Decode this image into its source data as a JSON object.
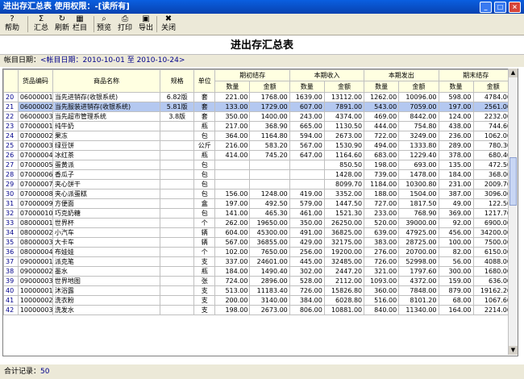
{
  "window": {
    "title": "进出存汇总表  使用权限：-[读所有]"
  },
  "toolbar": [
    {
      "label": "帮助",
      "icon": "help-icon",
      "glyph": "?"
    },
    {
      "label": "汇总",
      "icon": "sigma-icon",
      "glyph": "Σ"
    },
    {
      "label": "刷新",
      "icon": "refresh-icon",
      "glyph": "↻"
    },
    {
      "label": "栏目",
      "icon": "columns-icon",
      "glyph": "▦"
    },
    {
      "label": "预览",
      "icon": "preview-icon",
      "glyph": "⌕"
    },
    {
      "label": "打印",
      "icon": "print-icon",
      "glyph": "⎙"
    },
    {
      "label": "导出",
      "icon": "export-icon",
      "glyph": "▣"
    },
    {
      "label": "关闭",
      "icon": "close-icon",
      "glyph": "✖"
    }
  ],
  "report": {
    "title": "进出存汇总表",
    "date_label": "帐目日期：",
    "date_value": "<帐目日期：2010-10-01 至 2010-10-24>"
  },
  "columns": {
    "code": "货品编码",
    "name": "商品名称",
    "spec": "规格",
    "unit": "单位",
    "groups": [
      "期初结存",
      "本期收入",
      "本期发出",
      "期末结存"
    ],
    "qty": "数量",
    "amount": "金额"
  },
  "rows": [
    {
      "n": "20",
      "code": "06000001",
      "name": "当先进销存(收银系统)",
      "spec": "6.82版",
      "unit": "套",
      "v": [
        "221.00",
        "1768.00",
        "1639.00",
        "13112.00",
        "1262.00",
        "10096.00",
        "598.00",
        "4784.00"
      ]
    },
    {
      "n": "21",
      "code": "06000002",
      "name": "当先服装进销存(收银系统)",
      "spec": "5.81版",
      "unit": "套",
      "v": [
        "133.00",
        "1729.00",
        "607.00",
        "7891.00",
        "543.00",
        "7059.00",
        "197.00",
        "2561.00"
      ],
      "sel": true
    },
    {
      "n": "22",
      "code": "06000003",
      "name": "当先超市管理系统",
      "spec": "3.8版",
      "unit": "套",
      "v": [
        "350.00",
        "1400.00",
        "243.00",
        "4374.00",
        "469.00",
        "8442.00",
        "124.00",
        "2232.00"
      ]
    },
    {
      "n": "23",
      "code": "07000001",
      "name": "纯牛奶",
      "spec": "",
      "unit": "瓶",
      "v": [
        "217.00",
        "368.90",
        "665.00",
        "1130.50",
        "444.00",
        "754.80",
        "438.00",
        "744.60"
      ]
    },
    {
      "n": "24",
      "code": "07000002",
      "name": "果冻",
      "spec": "",
      "unit": "包",
      "v": [
        "364.00",
        "1164.80",
        "594.00",
        "2673.00",
        "722.00",
        "3249.00",
        "236.00",
        "1062.00"
      ]
    },
    {
      "n": "25",
      "code": "07000003",
      "name": "绿豆饼",
      "spec": "",
      "unit": "公斤",
      "v": [
        "216.00",
        "583.20",
        "567.00",
        "1530.90",
        "494.00",
        "1333.80",
        "289.00",
        "780.30"
      ]
    },
    {
      "n": "26",
      "code": "07000004",
      "name": "冰红茶",
      "spec": "",
      "unit": "瓶",
      "v": [
        "414.00",
        "745.20",
        "647.00",
        "1164.60",
        "683.00",
        "1229.40",
        "378.00",
        "680.40"
      ]
    },
    {
      "n": "27",
      "code": "07000005",
      "name": "蛋黄派",
      "spec": "",
      "unit": "包",
      "v": [
        "",
        "",
        "",
        "850.50",
        "198.00",
        "693.00",
        "135.00",
        "472.50"
      ]
    },
    {
      "n": "28",
      "code": "07000006",
      "name": "香瓜子",
      "spec": "",
      "unit": "包",
      "v": [
        "",
        "",
        "",
        "1428.00",
        "739.00",
        "1478.00",
        "184.00",
        "368.00"
      ]
    },
    {
      "n": "29",
      "code": "07000007",
      "name": "夹心饼干",
      "spec": "",
      "unit": "包",
      "v": [
        "",
        "",
        "",
        "8099.70",
        "1184.00",
        "10300.80",
        "231.00",
        "2009.70"
      ]
    },
    {
      "n": "30",
      "code": "07000008",
      "name": "夹心派蛋糕",
      "spec": "",
      "unit": "包",
      "v": [
        "156.00",
        "1248.00",
        "419.00",
        "3352.00",
        "188.00",
        "1504.00",
        "387.00",
        "3096.00"
      ]
    },
    {
      "n": "31",
      "code": "07000009",
      "name": "方便面",
      "spec": "",
      "unit": "盒",
      "v": [
        "197.00",
        "492.50",
        "579.00",
        "1447.50",
        "727.00",
        "1817.50",
        "49.00",
        "122.50"
      ]
    },
    {
      "n": "32",
      "code": "07000010",
      "name": "巧克奶糖",
      "spec": "",
      "unit": "包",
      "v": [
        "141.00",
        "465.30",
        "461.00",
        "1521.30",
        "233.00",
        "768.90",
        "369.00",
        "1217.70"
      ]
    },
    {
      "n": "33",
      "code": "08000001",
      "name": "世界杯",
      "spec": "",
      "unit": "个",
      "v": [
        "262.00",
        "19650.00",
        "350.00",
        "26250.00",
        "520.00",
        "39000.00",
        "92.00",
        "6900.00"
      ]
    },
    {
      "n": "34",
      "code": "08000002",
      "name": "小汽车",
      "spec": "",
      "unit": "辆",
      "v": [
        "604.00",
        "45300.00",
        "491.00",
        "36825.00",
        "639.00",
        "47925.00",
        "456.00",
        "34200.00"
      ]
    },
    {
      "n": "35",
      "code": "08000003",
      "name": "大卡车",
      "spec": "",
      "unit": "辆",
      "v": [
        "567.00",
        "36855.00",
        "429.00",
        "32175.00",
        "383.00",
        "28725.00",
        "100.00",
        "7500.00"
      ]
    },
    {
      "n": "36",
      "code": "08000004",
      "name": "布娃娃",
      "spec": "",
      "unit": "个",
      "v": [
        "102.00",
        "7650.00",
        "256.00",
        "19200.00",
        "276.00",
        "20700.00",
        "82.00",
        "6150.00"
      ]
    },
    {
      "n": "37",
      "code": "09000001",
      "name": "派克笔",
      "spec": "",
      "unit": "支",
      "v": [
        "337.00",
        "24601.00",
        "445.00",
        "32485.00",
        "726.00",
        "52998.00",
        "56.00",
        "4088.00"
      ]
    },
    {
      "n": "38",
      "code": "09000002",
      "name": "墨水",
      "spec": "",
      "unit": "瓶",
      "v": [
        "184.00",
        "1490.40",
        "302.00",
        "2447.20",
        "321.00",
        "1797.60",
        "300.00",
        "1680.00"
      ]
    },
    {
      "n": "39",
      "code": "09000003",
      "name": "世界地图",
      "spec": "",
      "unit": "张",
      "v": [
        "724.00",
        "2896.00",
        "528.00",
        "2112.00",
        "1093.00",
        "4372.00",
        "159.00",
        "636.00"
      ]
    },
    {
      "n": "40",
      "code": "10000001",
      "name": "沐浴露",
      "spec": "",
      "unit": "支",
      "v": [
        "513.00",
        "11183.40",
        "726.00",
        "15826.80",
        "360.00",
        "7848.00",
        "879.00",
        "19162.20"
      ]
    },
    {
      "n": "41",
      "code": "10000002",
      "name": "洗衣粉",
      "spec": "",
      "unit": "支",
      "v": [
        "200.00",
        "3140.00",
        "384.00",
        "6028.80",
        "516.00",
        "8101.20",
        "68.00",
        "1067.60"
      ]
    },
    {
      "n": "42",
      "code": "10000003",
      "name": "洗发水",
      "spec": "",
      "unit": "支",
      "v": [
        "198.00",
        "2673.00",
        "806.00",
        "10881.00",
        "840.00",
        "11340.00",
        "164.00",
        "2214.00"
      ]
    }
  ],
  "footer": {
    "label": "合计记录：",
    "count": "50"
  }
}
